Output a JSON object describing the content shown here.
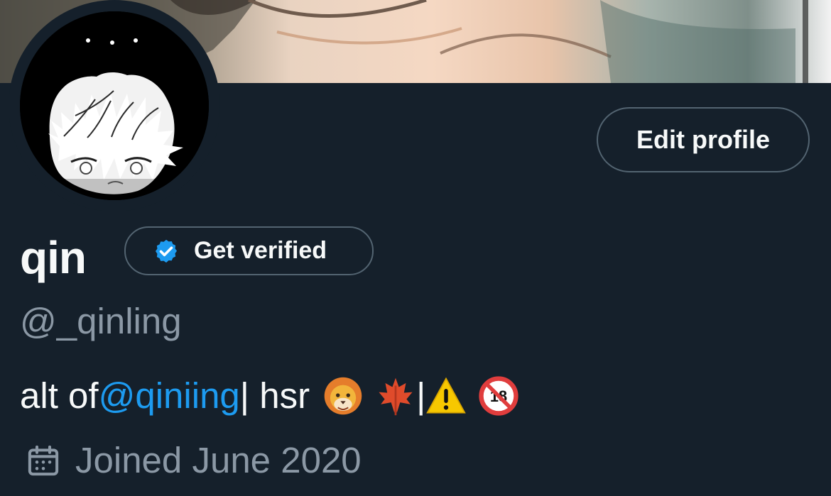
{
  "profile": {
    "display_name": "qin",
    "handle": "@_qinling",
    "bio_prefix": "alt of ",
    "bio_mention": "@qiniing",
    "bio_suffix": " | hsr",
    "bio_separator": "|",
    "bio_emojis": [
      "lion-face-icon",
      "maple-leaf-icon",
      "warning-icon",
      "no-one-under-eighteen-icon"
    ],
    "joined": "Joined June 2020"
  },
  "buttons": {
    "edit_profile": "Edit profile",
    "get_verified": "Get verified"
  },
  "colors": {
    "background": "#15202b",
    "text_primary": "#f7f9f9",
    "text_secondary": "#8b98a5",
    "border": "#536471",
    "accent": "#1d9bf0"
  }
}
